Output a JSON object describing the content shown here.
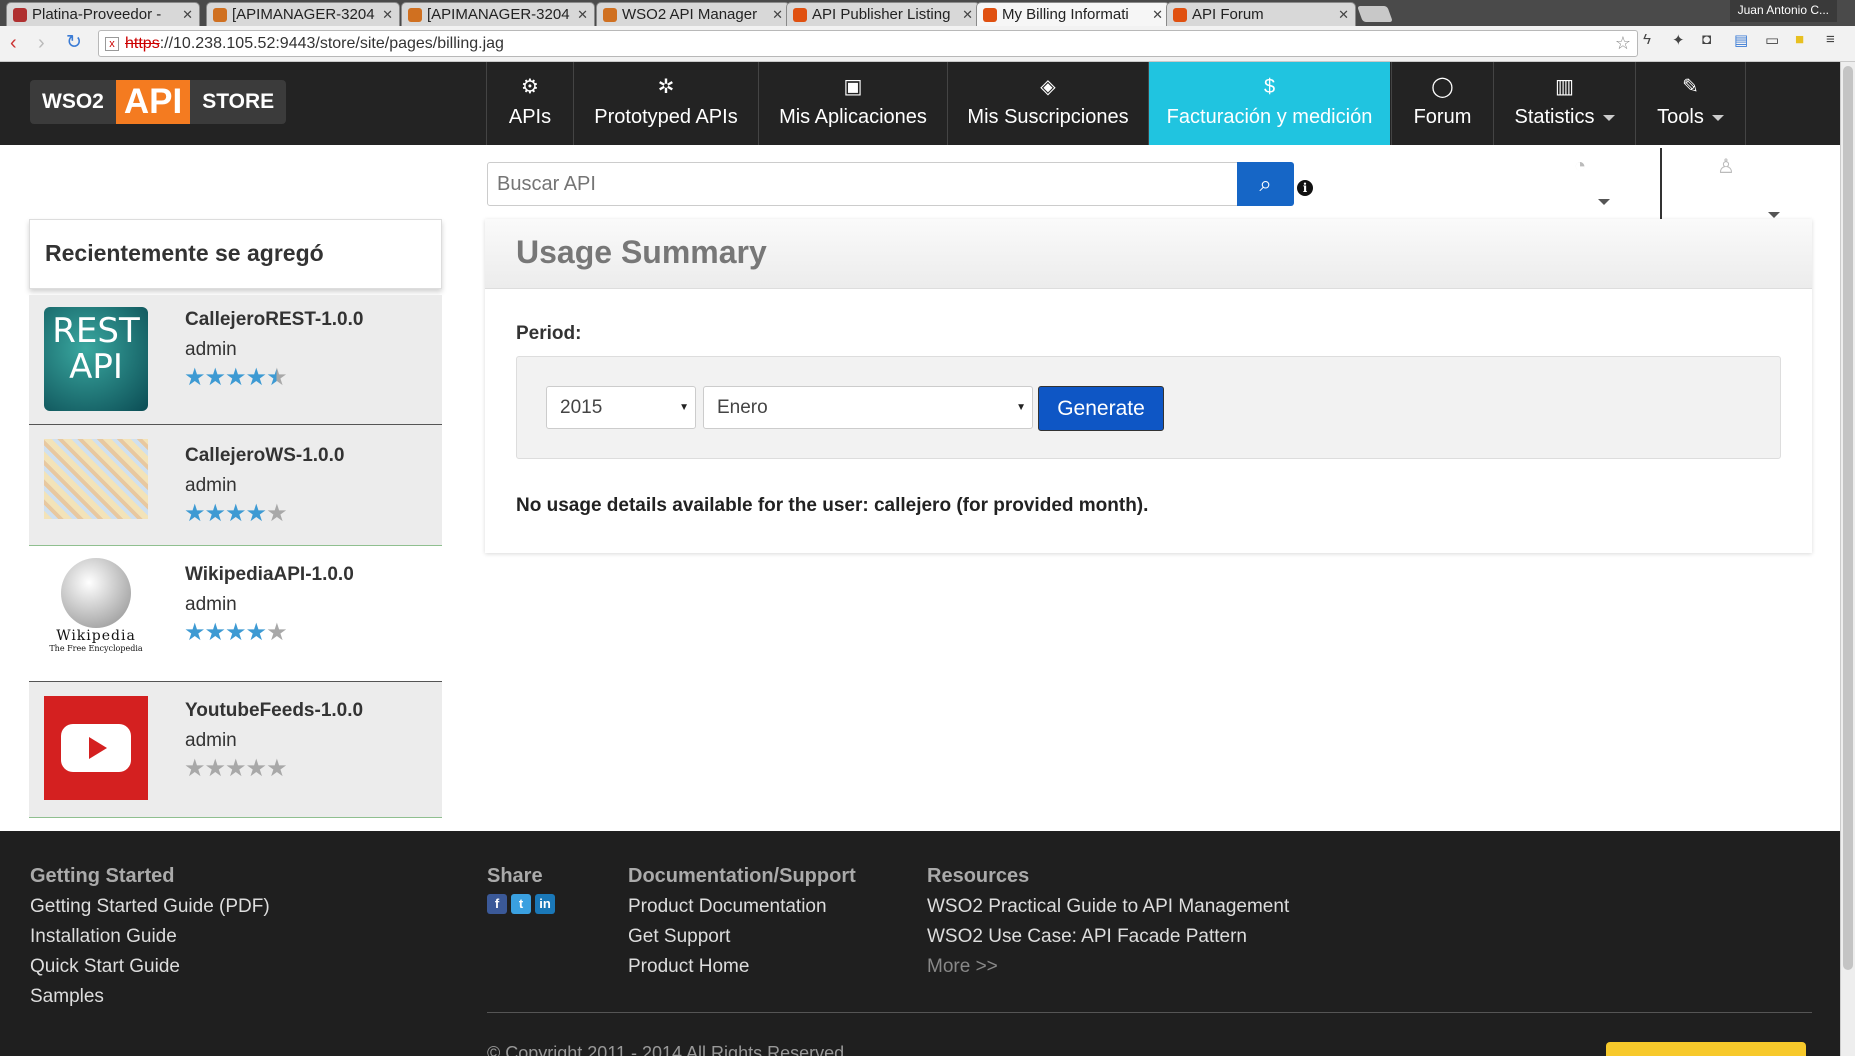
{
  "browser": {
    "tabs": [
      {
        "title": "Platina-Proveedor - ",
        "favicon_color": "#b03030"
      },
      {
        "title": "[APIMANAGER-3204",
        "favicon_color": "#d07020"
      },
      {
        "title": "[APIMANAGER-3204",
        "favicon_color": "#d07020"
      },
      {
        "title": "WSO2 API Manager",
        "favicon_color": "#d07020"
      },
      {
        "title": "API Publisher Listing",
        "favicon_color": "#e05010"
      },
      {
        "title": "My Billing Informati",
        "favicon_color": "#e05010"
      },
      {
        "title": "API Forum",
        "favicon_color": "#e05010"
      }
    ],
    "active_tab_index": 5,
    "profile_name": "Juan Antonio C...",
    "url_scheme": "https",
    "url_rest": "://10.238.105.52:9443/store/site/pages/billing.jag"
  },
  "logo": {
    "left": "WSO2",
    "mid": "API",
    "right": "STORE"
  },
  "nav": {
    "items": [
      {
        "label": "APIs",
        "icon": "gears-icon",
        "glyph": "⚙"
      },
      {
        "label": "Prototyped APIs",
        "icon": "gear-icon",
        "glyph": "✲"
      },
      {
        "label": "Mis Aplicaciones",
        "icon": "briefcase-icon",
        "glyph": "▣"
      },
      {
        "label": "Mis Suscripciones",
        "icon": "tags-icon",
        "glyph": "◈"
      },
      {
        "label": "Facturación y medición",
        "icon": "dollar-icon",
        "glyph": "$",
        "active": true
      },
      {
        "label": "Forum",
        "icon": "comment-icon",
        "glyph": "◯"
      },
      {
        "label": "Statistics",
        "icon": "bar-chart-icon",
        "glyph": "▥"
      },
      {
        "label": "Tools",
        "icon": "wrench-icon",
        "glyph": "✎"
      }
    ],
    "active_color": "#20c4e0"
  },
  "search": {
    "placeholder": "Buscar API"
  },
  "sidebar": {
    "title": "Recientemente se agregó",
    "items": [
      {
        "name": "CallejeroREST-1.0.0",
        "provider": "admin",
        "rating": 4.5,
        "thumb_text": "REST API"
      },
      {
        "name": "CallejeroWS-1.0.0",
        "provider": "admin",
        "rating": 4
      },
      {
        "name": "WikipediaAPI-1.0.0",
        "provider": "admin",
        "rating": 4,
        "thumb_text": "Wikipedia",
        "thumb_sub": "The Free Encyclopedia"
      },
      {
        "name": "YoutubeFeeds-1.0.0",
        "provider": "admin",
        "rating": 0
      }
    ]
  },
  "usage": {
    "title": "Usage Summary",
    "period_label": "Period:",
    "year": "2015",
    "month": "Enero",
    "generate_label": "Generate",
    "message": "No usage details available for the user:  callejero (for provided month)."
  },
  "footer": {
    "getting_started": {
      "title": "Getting Started",
      "links": [
        "Getting Started Guide (PDF)",
        "Installation Guide",
        "Quick Start Guide",
        "Samples"
      ]
    },
    "share": {
      "title": "Share"
    },
    "docs": {
      "title": "Documentation/Support",
      "links": [
        "Product Documentation",
        "Get Support",
        "Product Home"
      ]
    },
    "resources": {
      "title": "Resources",
      "links": [
        "WSO2 Practical Guide to API Management",
        "WSO2 Use Case: API Facade Pattern"
      ],
      "more": "More >>"
    },
    "copyright": "© Copyright 2011 - 2014 All Rights Reserved"
  }
}
